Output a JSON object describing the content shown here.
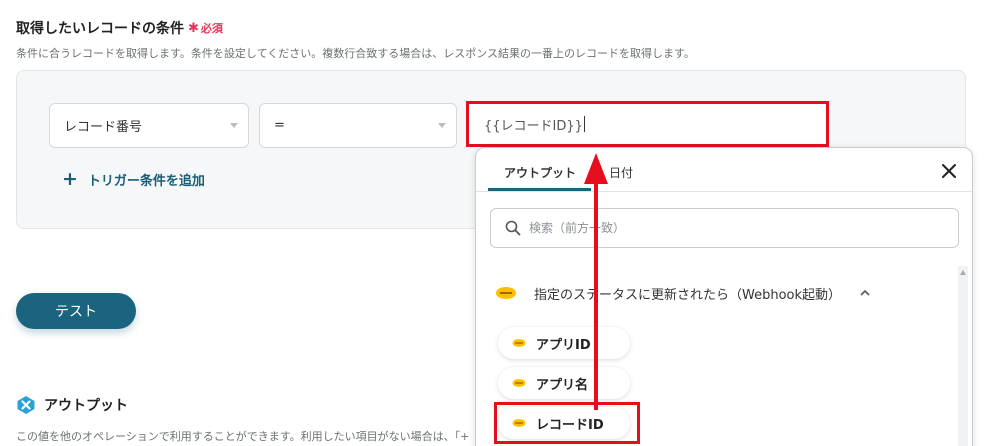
{
  "section": {
    "title": "取得したいレコードの条件",
    "required_star": "✱",
    "required_label": "必須",
    "description": "条件に合うレコードを取得します。条件を設定してください。複数行合致する場合は、レスポンス結果の一番上のレコードを取得します。"
  },
  "condition": {
    "field_select": "レコード番号",
    "operator_select": "=",
    "value": "{{レコードID}}",
    "add_trigger_icon": "+",
    "add_trigger_label": "トリガー条件を追加"
  },
  "test_button": "テスト",
  "output": {
    "title": "アウトプット",
    "description": "この値を他のオペレーションで利用することができます。利用したい項目がない場合は、「+"
  },
  "popup": {
    "tabs": [
      "アウトプット",
      "日付"
    ],
    "search_placeholder": "検索（前方一致）",
    "trigger_title": "指定のステータスに更新されたら（Webhook起動）",
    "items": [
      "アプリID",
      "アプリ名",
      "レコードID"
    ]
  },
  "icons": {
    "close": "close-icon",
    "search": "search-icon",
    "kintone": "kintone-icon",
    "chevron": "chevron-up-icon"
  },
  "colors": {
    "accent": "#1b6480",
    "highlight": "#e60d1e",
    "required": "#e2375a",
    "kintone": "#ffbe00"
  }
}
